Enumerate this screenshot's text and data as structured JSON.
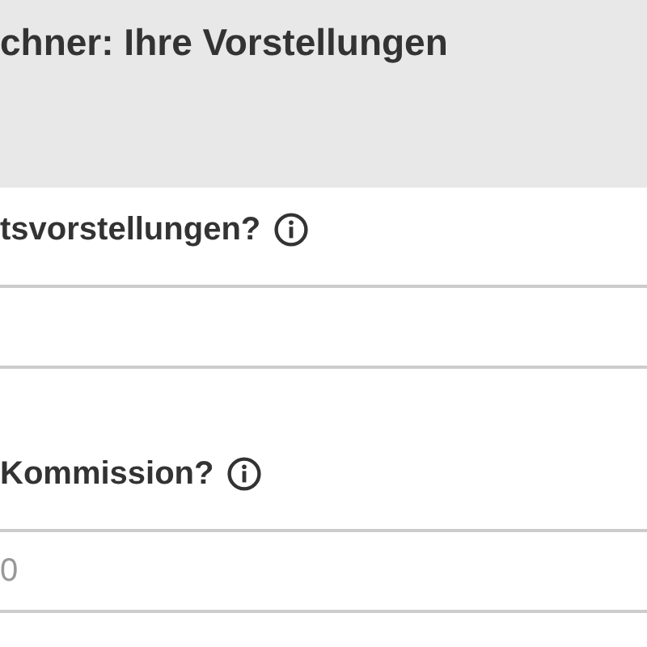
{
  "header": {
    "title": "chner: Ihre Vorstellungen"
  },
  "questions": [
    {
      "label": "tsvorstellungen?"
    },
    {
      "label": "Kommission?",
      "placeholder": "0"
    }
  ]
}
